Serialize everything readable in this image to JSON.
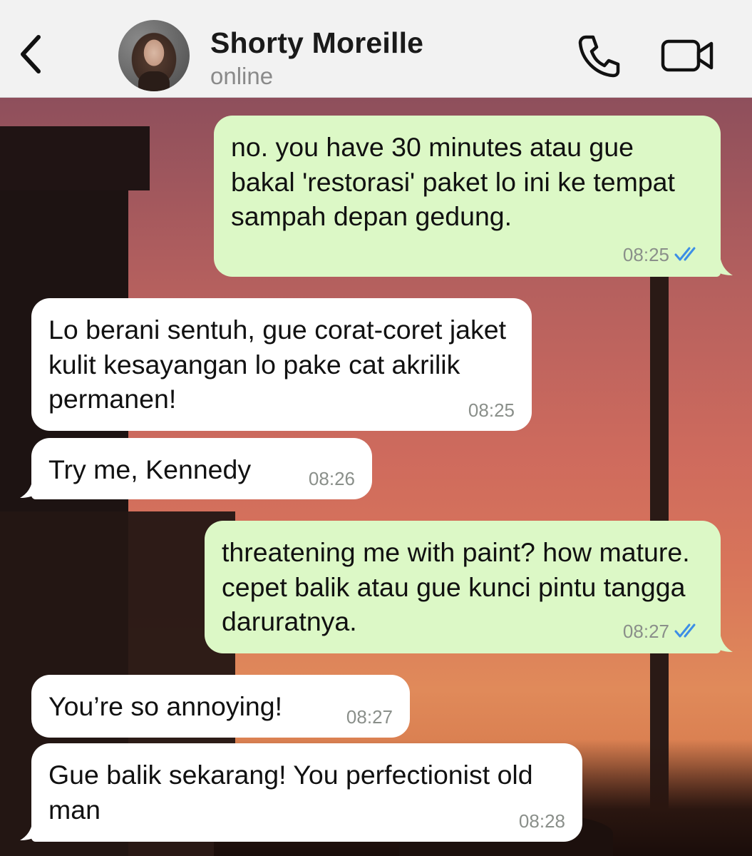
{
  "header": {
    "contact_name": "Shorty Moreille",
    "status": "online"
  },
  "colors": {
    "outgoing_bubble": "#dcf8c6",
    "incoming_bubble": "#ffffff",
    "read_ticks": "#3c8ee6",
    "header_bg": "#f2f2f2"
  },
  "icons": [
    "back-chevron-icon",
    "avatar",
    "phone-icon",
    "video-camera-icon",
    "double-check-read-icon"
  ],
  "messages": [
    {
      "direction": "outgoing",
      "text": "no. you have 30 minutes atau gue bakal 'restorasi' paket lo ini ke tempat sampah depan gedung.",
      "time": "08:25",
      "status": "read"
    },
    {
      "direction": "incoming",
      "text": "Lo berani sentuh, gue corat-coret jaket kulit kesayangan lo pake cat akrilik permanen!",
      "time": "08:25"
    },
    {
      "direction": "incoming",
      "text": "Try me, Kennedy",
      "time": "08:26"
    },
    {
      "direction": "outgoing",
      "text": "threatening me with paint? how mature. cepet balik atau gue kunci pintu tangga daruratnya.",
      "time": "08:27",
      "status": "read"
    },
    {
      "direction": "incoming",
      "text": "You’re so annoying!",
      "time": "08:27"
    },
    {
      "direction": "incoming",
      "text": "Gue balik sekarang! You perfectionist old man",
      "time": "08:28"
    }
  ]
}
